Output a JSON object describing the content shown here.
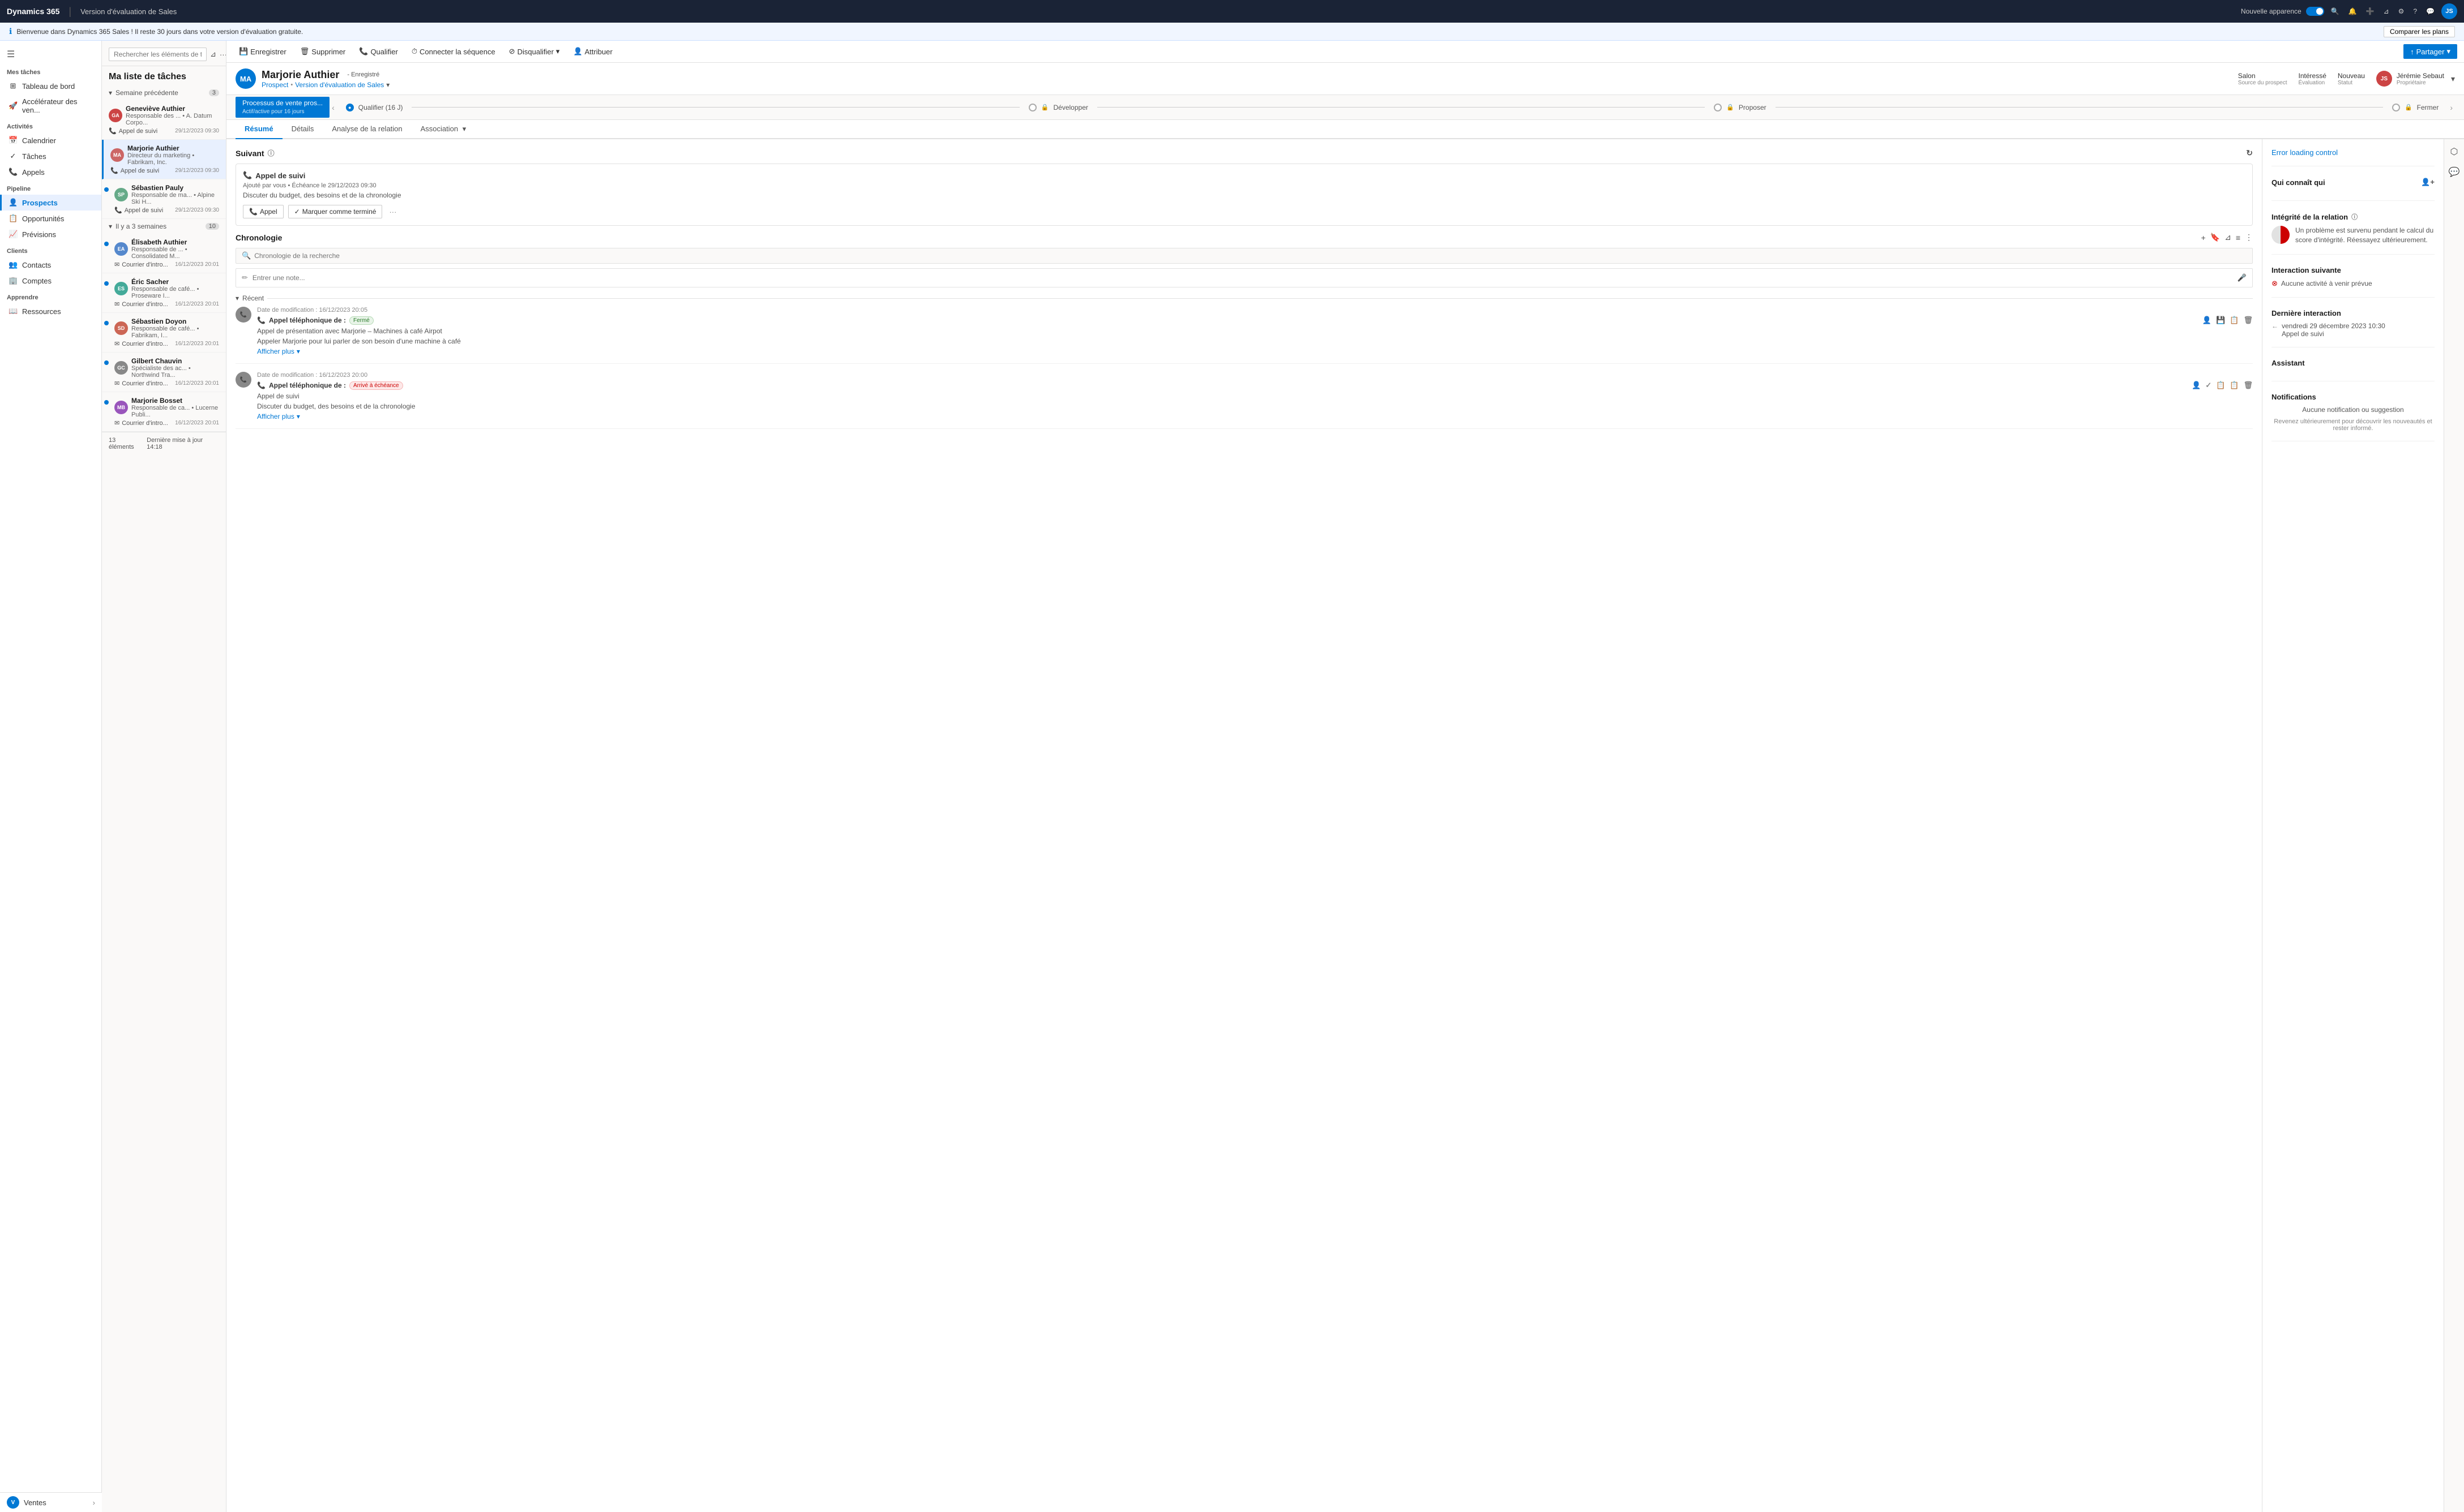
{
  "app": {
    "logo": "Dynamics 365",
    "divider": "|",
    "app_name": "Version d'évaluation de Sales",
    "new_look_label": "Nouvelle apparence"
  },
  "banner": {
    "text": "Bienvenue dans Dynamics 365 Sales ! Il reste 30 jours dans votre version d'évaluation gratuite.",
    "btn_label": "Comparer les plans"
  },
  "sidebar": {
    "hamburger": "☰",
    "sections": [
      {
        "title": "Mes tâches",
        "items": [
          {
            "icon": "⊞",
            "label": "Tableau de bord"
          },
          {
            "icon": "🚀",
            "label": "Accélérateur des ven..."
          }
        ]
      },
      {
        "title": "Activités",
        "items": [
          {
            "icon": "📅",
            "label": "Calendrier"
          },
          {
            "icon": "✓",
            "label": "Tâches"
          },
          {
            "icon": "📞",
            "label": "Appels"
          }
        ]
      },
      {
        "title": "Pipeline",
        "items": [
          {
            "icon": "👤",
            "label": "Prospects",
            "active": true
          },
          {
            "icon": "📋",
            "label": "Opportunités"
          },
          {
            "icon": "📈",
            "label": "Prévisions"
          }
        ]
      },
      {
        "title": "Clients",
        "items": [
          {
            "icon": "👥",
            "label": "Contacts"
          },
          {
            "icon": "🏢",
            "label": "Comptes"
          }
        ]
      },
      {
        "title": "Apprendre",
        "items": [
          {
            "icon": "📖",
            "label": "Ressources"
          }
        ]
      }
    ],
    "bottom": {
      "label": "Ventes",
      "initial": "V"
    }
  },
  "task_panel": {
    "search_placeholder": "Rechercher les éléments de travail",
    "title": "Ma liste de tâches",
    "sections": [
      {
        "label": "Semaine précédente",
        "count": 3,
        "collapsed": false,
        "items": [
          {
            "name": "Geneviève Authier",
            "role": "Responsable des ...",
            "company": "A. Datum Corpo...",
            "activity": "Appel de suivi",
            "date": "29/12/2023 09:30",
            "color": "#c44",
            "initials": "GA",
            "dot": false
          },
          {
            "name": "Marjorie Authier",
            "role": "Directeur du marketing",
            "company": "Fabrikam, Inc.",
            "activity": "Appel de suivi",
            "date": "29/12/2023 09:30",
            "color": "#c66",
            "initials": "MA",
            "dot": false,
            "selected": true
          },
          {
            "name": "Sébastien Pauly",
            "role": "Responsable de ma...",
            "company": "Alpine Ski H...",
            "activity": "Appel de suivi",
            "date": "29/12/2023 09:30",
            "color": "#6a8",
            "initials": "SP",
            "dot": true
          }
        ]
      },
      {
        "label": "Il y a 3 semaines",
        "count": 10,
        "collapsed": false,
        "items": [
          {
            "name": "Élisabeth Authier",
            "role": "Responsable de ...",
            "company": "Consolidated M...",
            "activity": "Courrier d'intro...",
            "date": "16/12/2023 20:01",
            "color": "#5588cc",
            "initials": "EA",
            "dot": true
          },
          {
            "name": "Éric Sacher",
            "role": "Responsable de café...",
            "company": "Proseware I...",
            "activity": "Courrier d'intro...",
            "date": "16/12/2023 20:01",
            "color": "#4a9",
            "initials": "ES",
            "dot": true
          },
          {
            "name": "Sébastien Doyon",
            "role": "Responsable de café...",
            "company": "Fabrikam, I...",
            "activity": "Courrier d'intro...",
            "date": "16/12/2023 20:01",
            "color": "#cc6655",
            "initials": "SD",
            "dot": true
          },
          {
            "name": "Gilbert Chauvin",
            "role": "Spécialiste des ac...",
            "company": "Northwind Tra...",
            "activity": "Courrier d'intro...",
            "date": "16/12/2023 20:01",
            "color": "#888",
            "initials": "GC",
            "dot": true
          },
          {
            "name": "Marjorie Bosset",
            "role": "Responsable de ca...",
            "company": "Lucerne Publi...",
            "activity": "Courrier d'intro...",
            "date": "16/12/2023 20:01",
            "color": "#9955bb",
            "initials": "MB",
            "dot": true
          }
        ]
      }
    ],
    "footer": {
      "count": "13 éléments",
      "last_update": "Dernière mise à jour 14:18"
    }
  },
  "toolbar": {
    "save_label": "Enregistrer",
    "delete_label": "Supprimer",
    "qualify_label": "Qualifier",
    "connect_sequence_label": "Connecter la séquence",
    "disqualify_label": "Disqualifier",
    "assign_label": "Attribuer",
    "share_label": "Partager"
  },
  "record": {
    "initials": "MA",
    "name": "Marjorie Authier",
    "status": "- Enregistré",
    "type": "Prospect",
    "eval_label": "Version d'évaluation de Sales",
    "meta": [
      {
        "label": "Salon",
        "value": "Source du prospect"
      },
      {
        "label": "Intéressé",
        "value": "Évaluation"
      },
      {
        "label": "Nouveau",
        "value": "Statut"
      }
    ],
    "owner_initials": "JS",
    "owner_name": "Jérémie Sebaut",
    "owner_label": "Propriétaire"
  },
  "process": {
    "active_label": "Processus de vente pros...",
    "active_sub": "Actif/active pour 16 jours",
    "stages": [
      {
        "label": "Qualifier",
        "sublabel": "(16 J)",
        "active": true,
        "lock": false
      },
      {
        "label": "Développer",
        "active": false,
        "lock": true
      },
      {
        "label": "Proposer",
        "active": false,
        "lock": true
      },
      {
        "label": "Fermer",
        "active": false,
        "lock": true
      }
    ]
  },
  "tabs": [
    {
      "label": "Résumé",
      "active": true
    },
    {
      "label": "Détails",
      "active": false
    },
    {
      "label": "Analyse de la relation",
      "active": false
    },
    {
      "label": "Association",
      "active": false
    }
  ],
  "suivant": {
    "title": "Suivant",
    "activity_title": "Appel de suivi",
    "activity_meta": "Ajouté par vous • Échéance le 29/12/2023 09:30",
    "activity_desc": "Discuter du budget, des besoins et de la chronologie",
    "btn_call": "Appel",
    "btn_done": "Marquer comme terminé"
  },
  "chronologie": {
    "title": "Chronologie",
    "search_placeholder": "Chronologie de la recherche",
    "note_placeholder": "Entrer une note...",
    "recent_label": "Récent",
    "items": [
      {
        "date": "Date de modification : 16/12/2023 20:05",
        "title": "Appel téléphonique de :",
        "status": "Fermé",
        "status_type": "ferme",
        "body1": "Appel de présentation avec Marjorie – Machines à café Airpot",
        "body2": "Appeler Marjorie pour lui parler de son besoin d'une machine à café",
        "show_more": "Afficher plus"
      },
      {
        "date": "Date de modification : 16/12/2023 20:00",
        "title": "Appel téléphonique de :",
        "status": "Arrivé à échéance",
        "status_type": "echéance",
        "body1": "Appel de suivi",
        "body2": "Discuter du budget, des besoins et de la chronologie",
        "show_more": "Afficher plus"
      }
    ]
  },
  "right_panel": {
    "error_label": "Error loading control",
    "who_knows": "Qui connaît qui",
    "integrity_title": "Intégrité de la relation",
    "integrity_text": "Un problème est survenu pendant le calcul du score d'intégrité. Réessayez ultérieurement.",
    "next_interaction_title": "Interaction suivante",
    "no_activity": "Aucune activité à venir prévue",
    "last_interaction_title": "Dernière interaction",
    "last_interaction_date": "vendredi 29 décembre 2023 10:30",
    "last_interaction_label": "Appel de suivi",
    "assistant_title": "Assistant",
    "notifications_title": "Notifications",
    "no_notif": "Aucune notification ou suggestion",
    "no_notif_sub": "Revenez ultérieurement pour découvrir les nouveautés et rester informé."
  },
  "avatar_colors": {
    "GA": "#c44",
    "MA": "#c66",
    "SP": "#6a8",
    "EA": "#5588cc",
    "ES": "#4a9",
    "SD": "#cc6655",
    "GC": "#888",
    "MB": "#9955bb"
  }
}
